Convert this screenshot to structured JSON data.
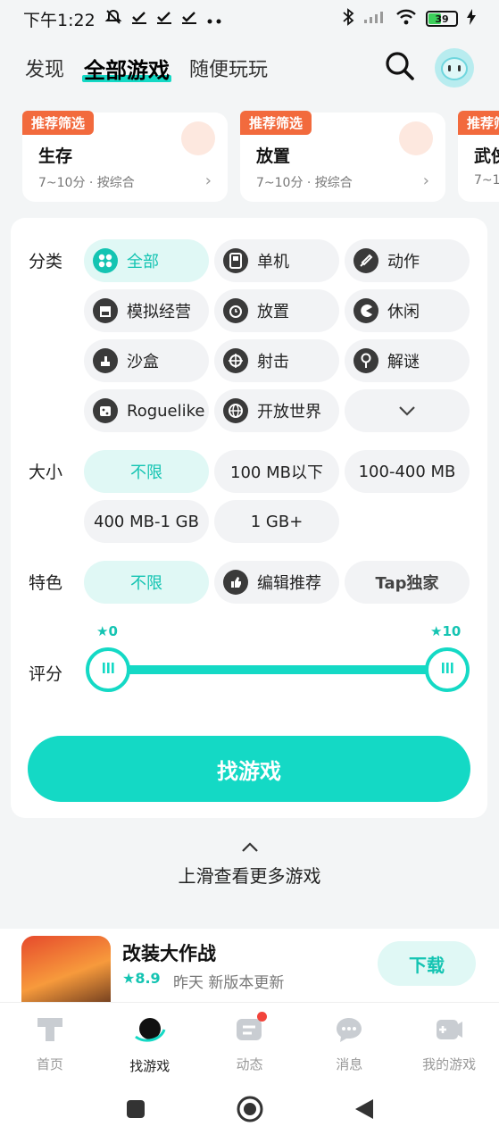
{
  "status_bar": {
    "time": "下午1:22",
    "battery": "39"
  },
  "top_nav": {
    "tabs": [
      {
        "label": "发现"
      },
      {
        "label": "全部游戏"
      },
      {
        "label": "随便玩玩"
      }
    ]
  },
  "recommendations": [
    {
      "badge": "推荐筛选",
      "title": "生存",
      "subtitle": "7~10分 · 按综合"
    },
    {
      "badge": "推荐筛选",
      "title": "放置",
      "subtitle": "7~10分 · 按综合"
    },
    {
      "badge": "推荐筛",
      "title": "武侠",
      "subtitle": "7~1"
    }
  ],
  "filters": {
    "category": {
      "label": "分类",
      "options": [
        "全部",
        "单机",
        "动作",
        "模拟经营",
        "放置",
        "休闲",
        "沙盒",
        "射击",
        "解谜",
        "Roguelike",
        "开放世界"
      ]
    },
    "size": {
      "label": "大小",
      "options": [
        "不限",
        "100 MB以下",
        "100-400 MB",
        "400 MB-1 GB",
        "1 GB+"
      ]
    },
    "feature": {
      "label": "特色",
      "options": [
        "不限",
        "编辑推荐",
        "Tap独家"
      ]
    },
    "rating": {
      "label": "评分",
      "min_label": "0",
      "max_label": "10",
      "range": [
        0,
        10
      ]
    },
    "find_button": "找游戏"
  },
  "more_hint": "上滑查看更多游戏",
  "game": {
    "name": "改装大作战",
    "rating": "8.9",
    "update_text": "昨天 新版本更新",
    "download_label": "下载"
  },
  "bottom_tabs": [
    {
      "label": "首页"
    },
    {
      "label": "找游戏"
    },
    {
      "label": "动态"
    },
    {
      "label": "消息"
    },
    {
      "label": "我的游戏"
    }
  ],
  "colors": {
    "accent": "#14d9c5",
    "badge": "#f26a3d",
    "notification": "#f2443b"
  }
}
